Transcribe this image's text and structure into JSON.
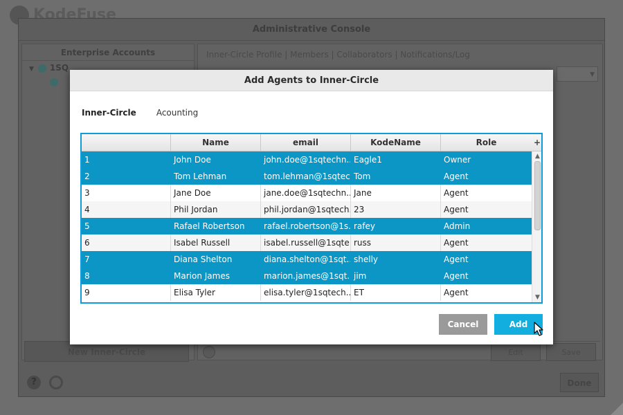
{
  "background": {
    "logo_text": "KodeFuse",
    "console_title": "Administrative Console",
    "left_panel_title": "Enterprise Accounts",
    "tree_root": "1SQ",
    "right_tabs": "Inner-Circle Profile | Members | Collaborators | Notifications/Log",
    "new_inner_circle_label": "New Inner-Circle",
    "right_btn_1": "Edit",
    "right_btn_2": "Save",
    "done_label": "Done"
  },
  "dialog": {
    "title": "Add Agents to Inner-Circle",
    "inner_circle_label": "Inner-Circle",
    "inner_circle_value": "Acounting",
    "columns": [
      "",
      "Name",
      "email",
      "KodeName",
      "Role"
    ],
    "add_column_glyph": "+",
    "rows": [
      {
        "num": "1",
        "name": "John Doe",
        "email": "john.doe@1sqtechn...",
        "kodename": "Eagle1",
        "role": "Owner",
        "selected": true
      },
      {
        "num": "2",
        "name": "Tom Lehman",
        "email": "tom.lehman@1sqtec...",
        "kodename": "Tom",
        "role": "Agent",
        "selected": true
      },
      {
        "num": "3",
        "name": "Jane Doe",
        "email": "jane.doe@1sqtechn...",
        "kodename": "Jane",
        "role": "Agent",
        "selected": false
      },
      {
        "num": "4",
        "name": "Phil Jordan",
        "email": "phil.jordan@1sqtech...",
        "kodename": "23",
        "role": "Agent",
        "selected": false
      },
      {
        "num": "5",
        "name": "Rafael Robertson",
        "email": "rafael.robertson@1s...",
        "kodename": "rafey",
        "role": "Admin",
        "selected": true
      },
      {
        "num": "6",
        "name": "Isabel Russell",
        "email": "isabel.russell@1sqte...",
        "kodename": "russ",
        "role": "Agent",
        "selected": false
      },
      {
        "num": "7",
        "name": "Diana Shelton",
        "email": "diana.shelton@1sqt...",
        "kodename": "shelly",
        "role": "Agent",
        "selected": true
      },
      {
        "num": "8",
        "name": "Marion James",
        "email": "marion.james@1sqt...",
        "kodename": "jim",
        "role": "Agent",
        "selected": true
      },
      {
        "num": "9",
        "name": "Elisa Tyler",
        "email": "elisa.tyler@1sqtech...",
        "kodename": "ET",
        "role": "Agent",
        "selected": false
      }
    ],
    "cancel_label": "Cancel",
    "add_label": "Add"
  },
  "colors": {
    "accent": "#12aee0",
    "selection": "#0b96c6",
    "table_border": "#0f9bd7",
    "cancel": "#9a9a9a"
  },
  "icons": {
    "help": "help-icon",
    "settings": "gear-icon",
    "scroll_up": "chevron-up-icon",
    "scroll_down": "chevron-down-icon",
    "cursor": "mouse-pointer-icon"
  }
}
